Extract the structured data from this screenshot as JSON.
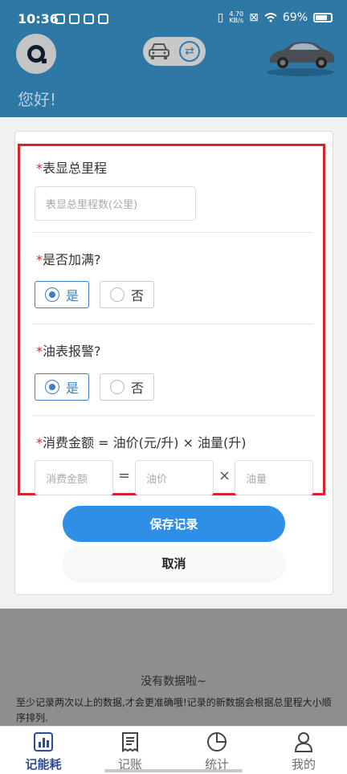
{
  "status_bar": {
    "time": "10:36",
    "speed_value": "4.70",
    "speed_unit": "KB/s",
    "battery": "69%"
  },
  "header": {
    "greeting": "您好!"
  },
  "form": {
    "odometer": {
      "required_mark": "*",
      "label": "表显总里程",
      "placeholder": "表显总里程数(公里)"
    },
    "full_tank": {
      "required_mark": "*",
      "label": "是否加满?",
      "options": [
        "是",
        "否"
      ],
      "selected": "是"
    },
    "fuel_warning": {
      "required_mark": "*",
      "label": "油表报警?",
      "options": [
        "是",
        "否"
      ],
      "selected": "是"
    },
    "amount": {
      "required_mark": "*",
      "label": "消费金额 = 油价(元/升) × 油量(升)",
      "amount_placeholder": "消费金额",
      "equals": "=",
      "price_placeholder": "油价",
      "times": "×",
      "volume_placeholder": "油量"
    },
    "save_label": "保存记录",
    "cancel_label": "取消"
  },
  "empty_state": {
    "title": "没有数据啦~",
    "description": "至少记录两次以上的数据,才会更准确哦!记录的新数据会根据总里程大小顺序排列."
  },
  "tabbar": {
    "tabs": [
      {
        "label": "记能耗",
        "icon": "bar-chart-icon",
        "active": true
      },
      {
        "label": "记账",
        "icon": "receipt-icon",
        "active": false
      },
      {
        "label": "统计",
        "icon": "pie-chart-icon",
        "active": false
      },
      {
        "label": "我的",
        "icon": "person-icon",
        "active": false
      }
    ]
  },
  "colors": {
    "header": "#2e78a6",
    "accent": "#2f8fe6",
    "required": "#d8232a",
    "highlight_box": "#d8232a",
    "active_tab": "#2e4a93"
  }
}
